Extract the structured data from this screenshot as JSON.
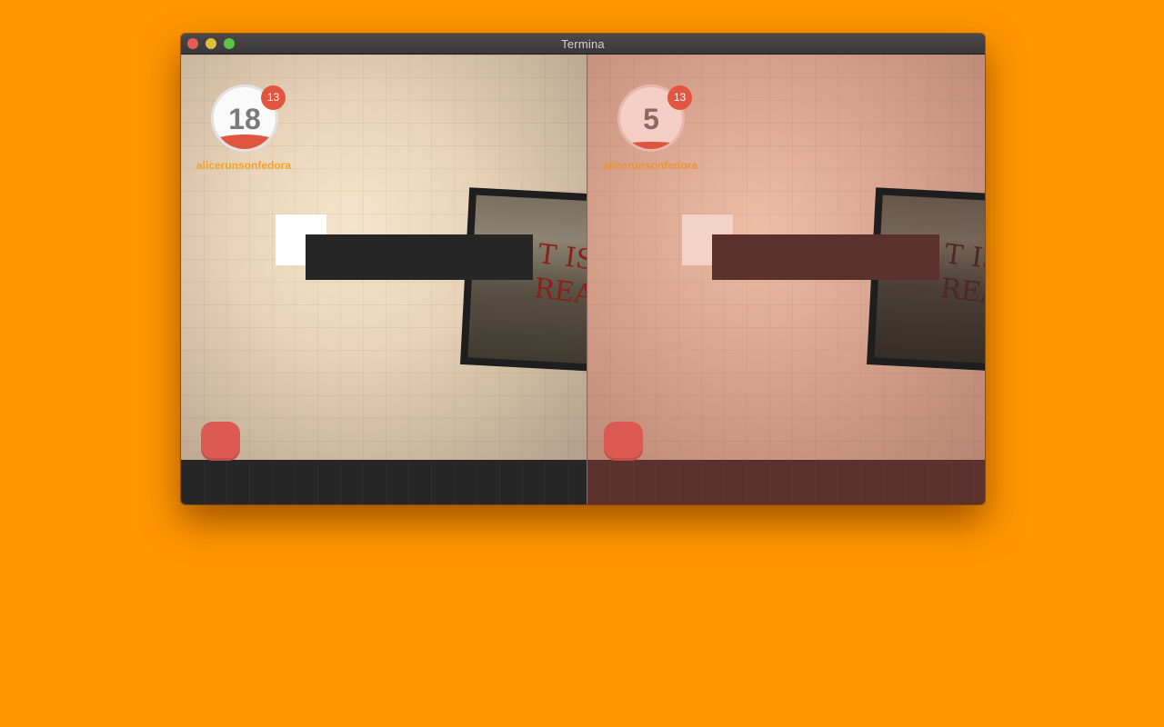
{
  "window": {
    "title": "Termina"
  },
  "left_pane": {
    "score": "18",
    "badge": "13",
    "username": "alicerunsonfedora",
    "photo_text": "T IS\nREA"
  },
  "right_pane": {
    "score": "5",
    "badge": "13",
    "username": "alicerunsonfedora",
    "photo_text": "T IS\nREA"
  },
  "colors": {
    "desktop": "#ff9600",
    "player": "#dc5a52",
    "badge": "#e2553f",
    "username": "#f0a423",
    "platform": "#262626"
  }
}
